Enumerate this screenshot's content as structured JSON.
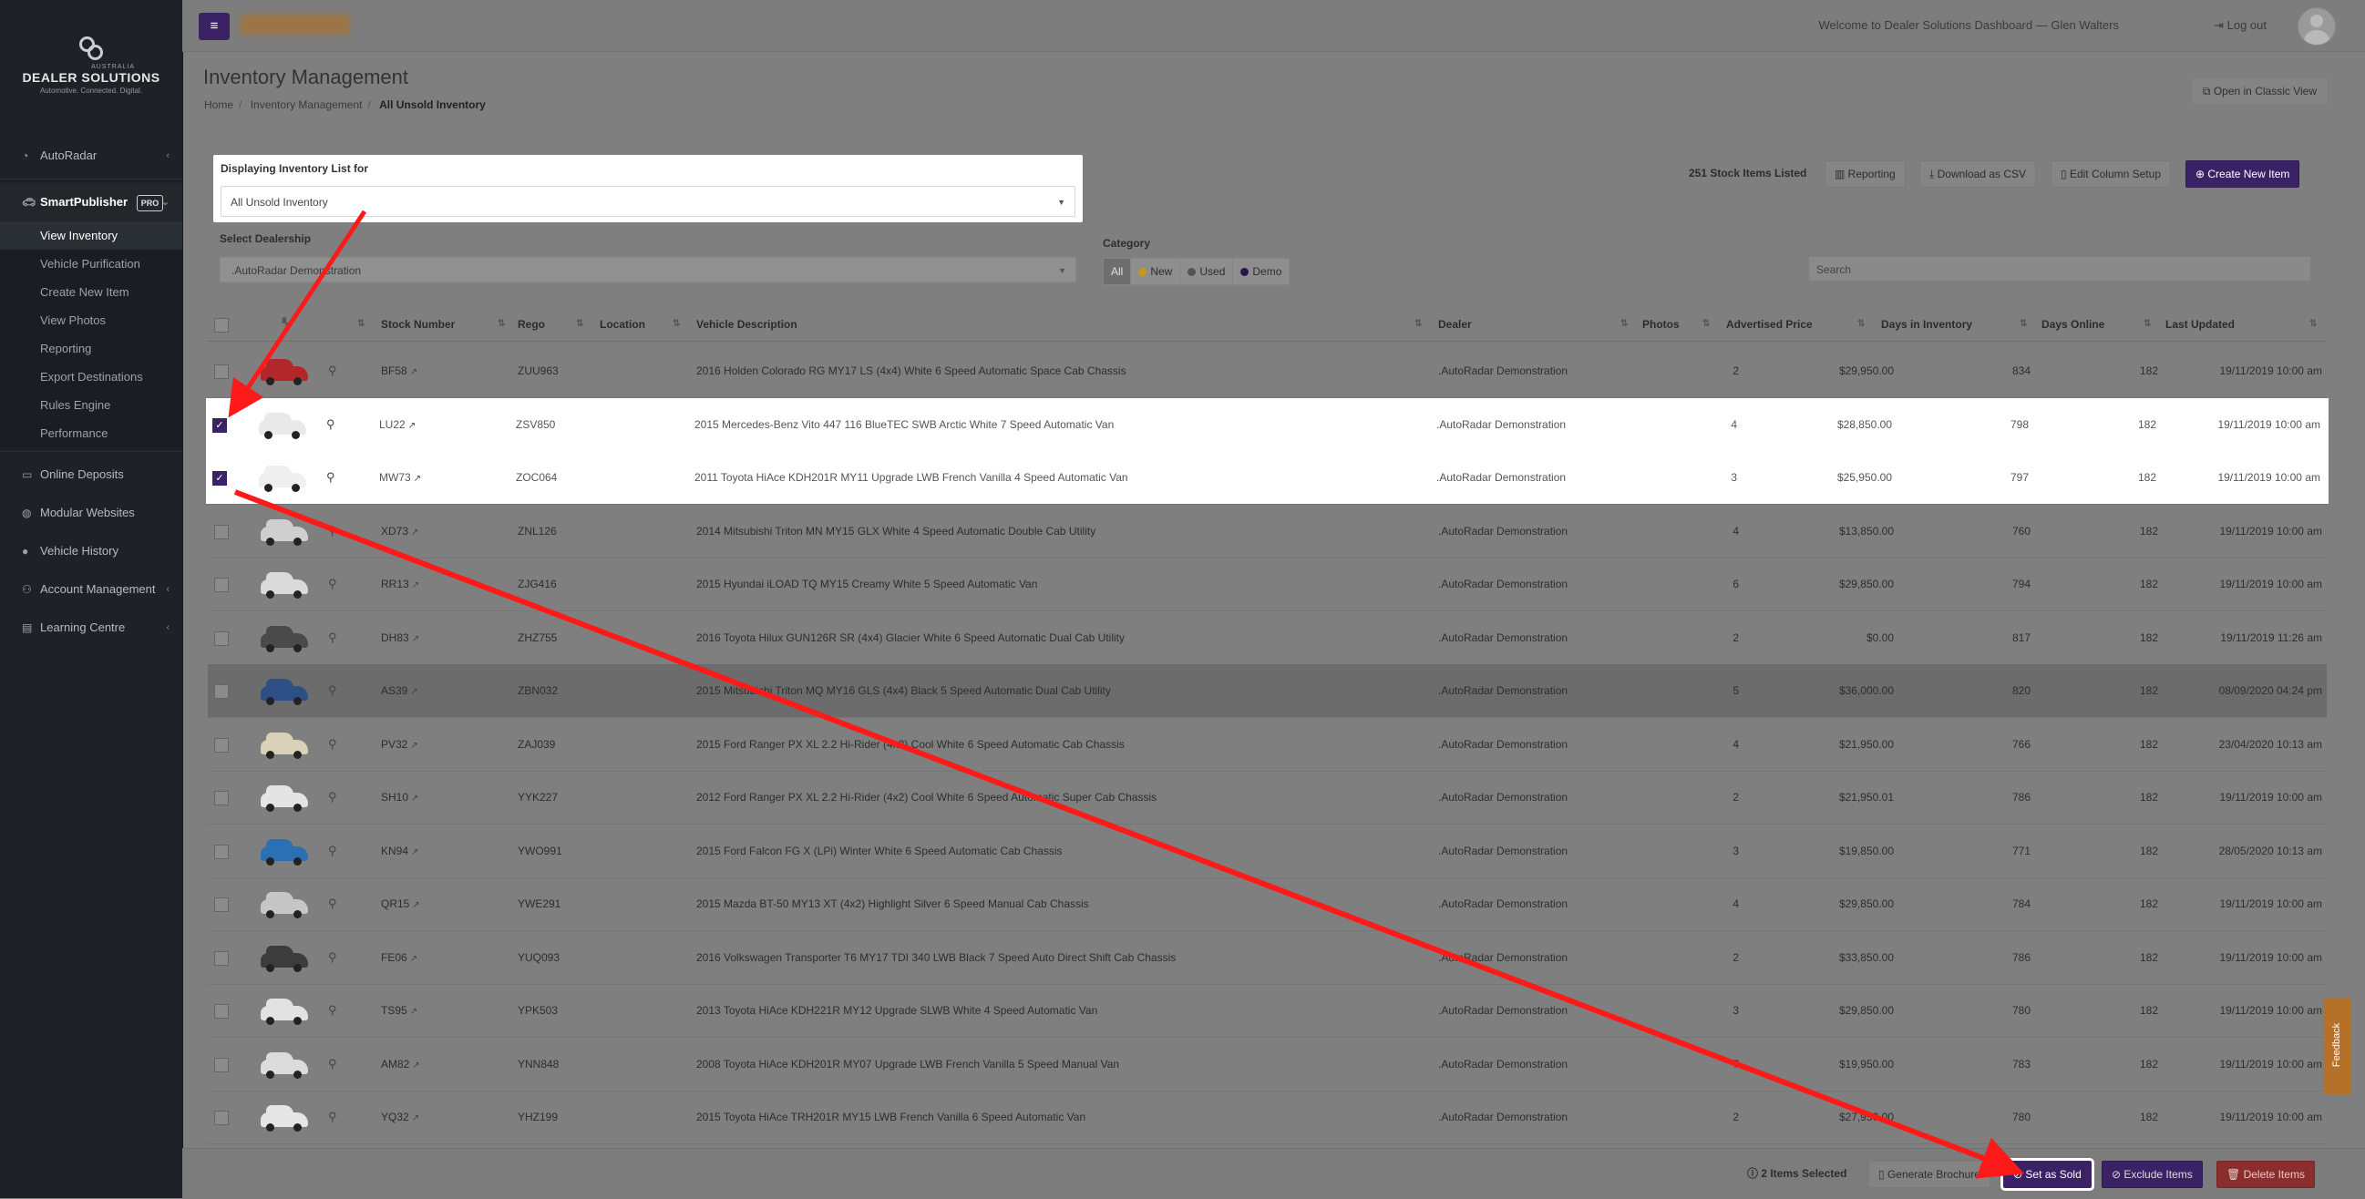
{
  "brand": {
    "country": "AUSTRALIA",
    "name": "DEALER SOLUTIONS",
    "tagline": "Automotive. Connected. Digital."
  },
  "sidebar": {
    "autoradar": "AutoRadar",
    "smartpublisher": "SmartPublisher",
    "pro_badge": "PRO",
    "sub_items": [
      "View Inventory",
      "Vehicle Purification",
      "Create New Item",
      "View Photos",
      "Reporting",
      "Export Destinations",
      "Rules Engine",
      "Performance"
    ],
    "online_deposits": "Online Deposits",
    "modular_websites": "Modular Websites",
    "vehicle_history": "Vehicle History",
    "account_management": "Account Management",
    "learning_centre": "Learning Centre"
  },
  "topbar": {
    "welcome": "Welcome to Dealer Solutions Dashboard — Glen Walters",
    "logout": "Log out"
  },
  "page": {
    "title": "Inventory Management",
    "breadcrumb": [
      "Home",
      "Inventory Management",
      "All Unsold Inventory"
    ],
    "classic_view": "Open in Classic View"
  },
  "filters": {
    "list_label": "Displaying Inventory List for",
    "list_value": "All Unsold Inventory",
    "dealer_label": "Select Dealership",
    "dealer_value": ".AutoRadar Demonstration",
    "category_label": "Category",
    "categories": [
      "All",
      "New",
      "Used",
      "Demo"
    ],
    "category_colors": [
      "",
      "#c79a12",
      "#555555",
      "#2a1648"
    ],
    "search_placeholder": "Search"
  },
  "actions": {
    "stock_count": "251 Stock Items Listed",
    "reporting": "Reporting",
    "download_csv": "Download as CSV",
    "edit_columns": "Edit Column Setup",
    "create_new": "Create New Item"
  },
  "table": {
    "headers": [
      "Stock Number",
      "Rego",
      "Location",
      "Vehicle Description",
      "Dealer",
      "Photos",
      "Advertised Price",
      "Days in Inventory",
      "Days Online",
      "Last Updated"
    ],
    "rows": [
      {
        "stock": "BF58",
        "rego": "ZUU963",
        "desc": "2016 Holden Colorado RG MY17 LS (4x4) White 6 Speed Automatic Space Cab Chassis",
        "dealer": ".AutoRadar Demonstration",
        "photos": "2",
        "price": "$29,950.00",
        "days_inv": "834",
        "days_online": "182",
        "updated": "19/11/2019 10:00 am",
        "car_color": "#b3262a",
        "checked": false
      },
      {
        "stock": "LU22",
        "rego": "ZSV850",
        "desc": "2015 Mercedes-Benz Vito 447 116 BlueTEC SWB Arctic White 7 Speed Automatic Van",
        "dealer": ".AutoRadar Demonstration",
        "photos": "4",
        "price": "$28,850.00",
        "days_inv": "798",
        "days_online": "182",
        "updated": "19/11/2019 10:00 am",
        "car_color": "#e9e9e9",
        "checked": true
      },
      {
        "stock": "MW73",
        "rego": "ZOC064",
        "desc": "2011 Toyota HiAce KDH201R MY11 Upgrade LWB French Vanilla 4 Speed Automatic Van",
        "dealer": ".AutoRadar Demonstration",
        "photos": "3",
        "price": "$25,950.00",
        "days_inv": "797",
        "days_online": "182",
        "updated": "19/11/2019 10:00 am",
        "car_color": "#efefef",
        "checked": true
      },
      {
        "stock": "XD73",
        "rego": "ZNL126",
        "desc": "2014 Mitsubishi Triton MN MY15 GLX White 4 Speed Automatic Double Cab Utility",
        "dealer": ".AutoRadar Demonstration",
        "photos": "4",
        "price": "$13,850.00",
        "days_inv": "760",
        "days_online": "182",
        "updated": "19/11/2019 10:00 am",
        "car_color": "#cfcfcf",
        "checked": false
      },
      {
        "stock": "RR13",
        "rego": "ZJG416",
        "desc": "2015 Hyundai iLOAD TQ MY15 Creamy White 5 Speed Automatic Van",
        "dealer": ".AutoRadar Demonstration",
        "photos": "6",
        "price": "$29,850.00",
        "days_inv": "794",
        "days_online": "182",
        "updated": "19/11/2019 10:00 am",
        "car_color": "#dadada",
        "checked": false
      },
      {
        "stock": "DH83",
        "rego": "ZHZ755",
        "desc": "2016 Toyota Hilux GUN126R SR (4x4) Glacier White 6 Speed Automatic Dual Cab Utility",
        "dealer": ".AutoRadar Demonstration",
        "photos": "2",
        "price": "$0.00",
        "days_inv": "817",
        "days_online": "182",
        "updated": "19/11/2019 11:26 am",
        "car_color": "#4a4a4a",
        "checked": false
      },
      {
        "stock": "AS39",
        "rego": "ZBN032",
        "desc": "2015 Mitsubishi Triton MQ MY16 GLS (4x4) Black 5 Speed Automatic Dual Cab Utility",
        "dealer": ".AutoRadar Demonstration",
        "photos": "5",
        "price": "$36,000.00",
        "days_inv": "820",
        "days_online": "182",
        "updated": "08/09/2020 04:24 pm",
        "car_color": "#2d4f86",
        "checked": false
      },
      {
        "stock": "PV32",
        "rego": "ZAJ039",
        "desc": "2015 Ford Ranger PX XL 2.2 Hi-Rider (4x2) Cool White 6 Speed Automatic Cab Chassis",
        "dealer": ".AutoRadar Demonstration",
        "photos": "4",
        "price": "$21,950.00",
        "days_inv": "766",
        "days_online": "182",
        "updated": "23/04/2020 10:13 am",
        "car_color": "#d9d2b8",
        "checked": false
      },
      {
        "stock": "SH10",
        "rego": "YYK227",
        "desc": "2012 Ford Ranger PX XL 2.2 Hi-Rider (4x2) Cool White 6 Speed Automatic Super Cab Chassis",
        "dealer": ".AutoRadar Demonstration",
        "photos": "2",
        "price": "$21,950.01",
        "days_inv": "786",
        "days_online": "182",
        "updated": "19/11/2019 10:00 am",
        "car_color": "#e4e4e4",
        "checked": false
      },
      {
        "stock": "KN94",
        "rego": "YWO991",
        "desc": "2015 Ford Falcon FG X (LPi) Winter White 6 Speed Automatic Cab Chassis",
        "dealer": ".AutoRadar Demonstration",
        "photos": "3",
        "price": "$19,850.00",
        "days_inv": "771",
        "days_online": "182",
        "updated": "28/05/2020 10:13 am",
        "car_color": "#2c6fb3",
        "checked": false
      },
      {
        "stock": "QR15",
        "rego": "YWE291",
        "desc": "2015 Mazda BT-50 MY13 XT (4x2) Highlight Silver 6 Speed Manual Cab Chassis",
        "dealer": ".AutoRadar Demonstration",
        "photos": "4",
        "price": "$29,850.00",
        "days_inv": "784",
        "days_online": "182",
        "updated": "19/11/2019 10:00 am",
        "car_color": "#c6c6c6",
        "checked": false
      },
      {
        "stock": "FE06",
        "rego": "YUQ093",
        "desc": "2016 Volkswagen Transporter T6 MY17 TDI 340 LWB Black 7 Speed Auto Direct Shift Cab Chassis",
        "dealer": ".AutoRadar Demonstration",
        "photos": "2",
        "price": "$33,850.00",
        "days_inv": "786",
        "days_online": "182",
        "updated": "19/11/2019 10:00 am",
        "car_color": "#3c3c3c",
        "checked": false
      },
      {
        "stock": "TS95",
        "rego": "YPK503",
        "desc": "2013 Toyota HiAce KDH221R MY12 Upgrade SLWB White 4 Speed Automatic Van",
        "dealer": ".AutoRadar Demonstration",
        "photos": "3",
        "price": "$29,850.00",
        "days_inv": "780",
        "days_online": "182",
        "updated": "19/11/2019 10:00 am",
        "car_color": "#e2e2e2",
        "checked": false
      },
      {
        "stock": "AM82",
        "rego": "YNN848",
        "desc": "2008 Toyota HiAce KDH201R MY07 Upgrade LWB French Vanilla 5 Speed Manual Van",
        "dealer": ".AutoRadar Demonstration",
        "photos": "7",
        "price": "$19,950.00",
        "days_inv": "783",
        "days_online": "182",
        "updated": "19/11/2019 10:00 am",
        "car_color": "#dcdcdc",
        "checked": false
      },
      {
        "stock": "YQ32",
        "rego": "YHZ199",
        "desc": "2015 Toyota HiAce TRH201R MY15 LWB French Vanilla 6 Speed Automatic Van",
        "dealer": ".AutoRadar Demonstration",
        "photos": "2",
        "price": "$27,950.00",
        "days_inv": "780",
        "days_online": "182",
        "updated": "19/11/2019 10:00 am",
        "car_color": "#e6e6e6",
        "checked": false
      }
    ]
  },
  "footer": {
    "selected": "2 Items Selected",
    "brochure": "Generate Brochure",
    "set_sold": "Set as Sold",
    "exclude": "Exclude Items",
    "delete": "Delete Items"
  },
  "feedback": "Feedback",
  "colors": {
    "accent": "#3b2166",
    "arrow": "#ff1a1a"
  }
}
